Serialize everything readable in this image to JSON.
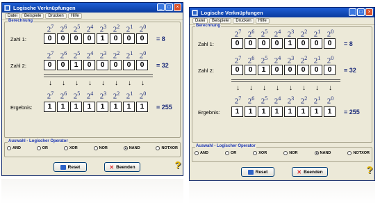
{
  "windows": [
    {
      "title": "Logische Verknüpfungen",
      "menu": [
        "Datei",
        "Beispiele",
        "Drucken",
        "Hilfe"
      ],
      "group_calc": "Berechnung",
      "powers": [
        7,
        6,
        5,
        4,
        3,
        2,
        1,
        0
      ],
      "power_base": "2",
      "row1": {
        "label": "Zahl 1:",
        "bits": [
          "0",
          "0",
          "0",
          "0",
          "1",
          "0",
          "0",
          "0"
        ],
        "result": "= 8"
      },
      "row2": {
        "label": "Zahl 2:",
        "bits": [
          "0",
          "0",
          "1",
          "0",
          "0",
          "0",
          "0",
          "0"
        ],
        "result": "= 32"
      },
      "row3": {
        "label": "Ergebnis:",
        "bits": [
          "1",
          "1",
          "1",
          "1",
          "1",
          "1",
          "1",
          "1"
        ],
        "result": "= 255"
      },
      "group_ops": "Auswahl - Logischer Operator",
      "operators": [
        {
          "label": "AND",
          "checked": false
        },
        {
          "label": "OR",
          "checked": false
        },
        {
          "label": "XOR",
          "checked": false
        },
        {
          "label": "NOR",
          "checked": false
        },
        {
          "label": "NAND",
          "checked": true
        },
        {
          "label": "NOTXOR",
          "checked": false
        }
      ],
      "reset_label": "Reset",
      "quit_label": "Beenden",
      "help_glyph": "?"
    },
    {
      "title": "Logische Verknüpfungen",
      "menu": [
        "Datei",
        "Beispiele",
        "Drucken",
        "Hilfe"
      ],
      "group_calc": "Berechnung",
      "powers": [
        7,
        6,
        5,
        4,
        3,
        2,
        1,
        0
      ],
      "power_base": "2",
      "row1": {
        "label": "Zahl 1:",
        "bits": [
          "0",
          "0",
          "0",
          "0",
          "1",
          "0",
          "0",
          "0"
        ],
        "result": "= 8"
      },
      "row2": {
        "label": "Zahl 2:",
        "bits": [
          "0",
          "0",
          "1",
          "0",
          "0",
          "0",
          "0",
          "0"
        ],
        "result": "= 32"
      },
      "row3": {
        "label": "Ergebnis:",
        "bits": [
          "1",
          "1",
          "1",
          "1",
          "1",
          "1",
          "1",
          "1"
        ],
        "result": "= 255"
      },
      "group_ops": "Auswahl - Logischer Operator",
      "operators": [
        {
          "label": "AND",
          "checked": false
        },
        {
          "label": "OR",
          "checked": false
        },
        {
          "label": "XOR",
          "checked": false
        },
        {
          "label": "NOR",
          "checked": false
        },
        {
          "label": "NAND",
          "checked": true
        },
        {
          "label": "NOTXOR",
          "checked": false
        }
      ],
      "reset_label": "Reset",
      "quit_label": "Beenden",
      "help_glyph": "?"
    }
  ],
  "colors": {
    "accent": "#1a35b5",
    "titlebar": "#1f5fd6",
    "window_bg": "#ece9d8"
  },
  "icons": [
    "app-icon",
    "minimize-icon",
    "maximize-icon",
    "close-icon",
    "reset-icon",
    "close-x-icon",
    "help-icon"
  ]
}
